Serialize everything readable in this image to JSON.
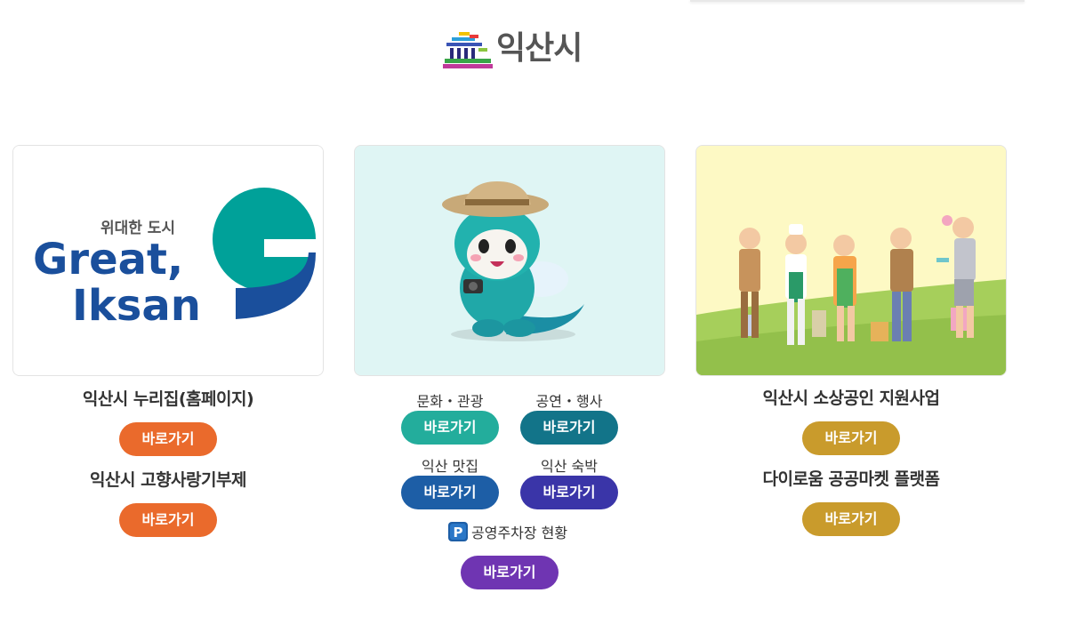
{
  "site": {
    "logo_text": "익산시"
  },
  "colors": {
    "orange": "#ea6a2c",
    "teal": "#23ad9c",
    "dark_teal": "#127489",
    "navy": "#1d5ea6",
    "indigo": "#3a35a8",
    "purple": "#6f35b2",
    "gold": "#c99b2c"
  },
  "cards": [
    {
      "image": {
        "tagline": "위대한 도시",
        "brand_line1": "Great,",
        "brand_line2": "Iksan"
      },
      "links": [
        {
          "title": "익산시 누리집(홈페이지)",
          "button": "바로가기"
        },
        {
          "title": "익산시 고향사랑기부제",
          "button": "바로가기"
        }
      ]
    },
    {
      "image": {
        "alt": "mascot"
      },
      "links": [
        {
          "label": "문화・관광",
          "button": "바로가기"
        },
        {
          "label": "공연・행사",
          "button": "바로가기"
        },
        {
          "label": "익산 맛집",
          "button": "바로가기"
        },
        {
          "label": "익산 숙박",
          "button": "바로가기"
        }
      ],
      "parking": {
        "icon": "P",
        "label": "공영주차장 현황",
        "button": "바로가기"
      }
    },
    {
      "image": {
        "alt": "small business people"
      },
      "links": [
        {
          "title": "익산시 소상공인 지원사업",
          "button": "바로가기"
        },
        {
          "title": "다이로움 공공마켓 플랫폼",
          "button": "바로가기"
        }
      ]
    }
  ]
}
